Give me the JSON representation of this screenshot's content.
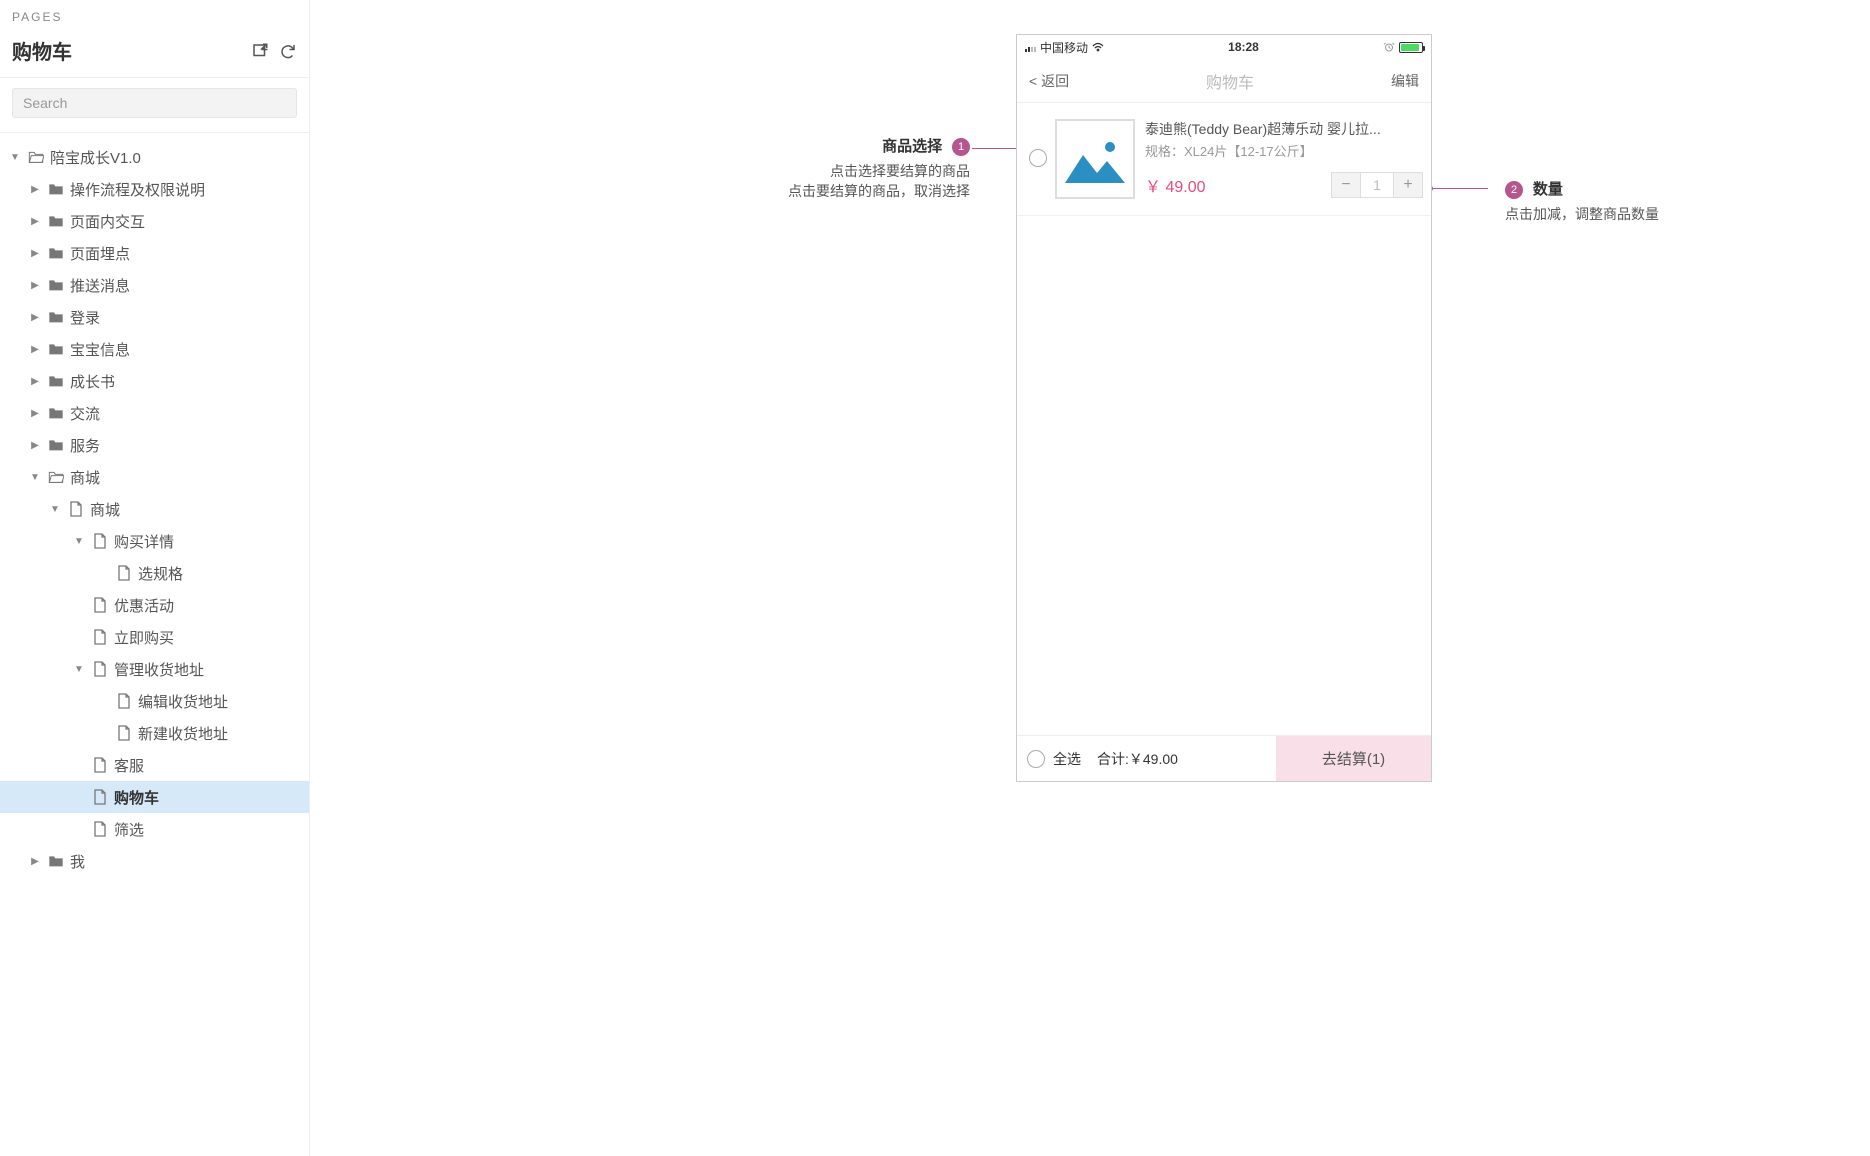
{
  "sidebar": {
    "header": "PAGES",
    "current_page": "购物车",
    "search_placeholder": "Search",
    "tree": [
      {
        "label": "陪宝成长V1.0",
        "indent": 0,
        "icon": "folder-open",
        "caret": "down"
      },
      {
        "label": "操作流程及权限说明",
        "indent": 1,
        "icon": "folder",
        "caret": "right"
      },
      {
        "label": "页面内交互",
        "indent": 1,
        "icon": "folder",
        "caret": "right"
      },
      {
        "label": "页面埋点",
        "indent": 1,
        "icon": "folder",
        "caret": "right"
      },
      {
        "label": "推送消息",
        "indent": 1,
        "icon": "folder",
        "caret": "right"
      },
      {
        "label": "登录",
        "indent": 1,
        "icon": "folder",
        "caret": "right"
      },
      {
        "label": "宝宝信息",
        "indent": 1,
        "icon": "folder",
        "caret": "right"
      },
      {
        "label": "成长书",
        "indent": 1,
        "icon": "folder",
        "caret": "right"
      },
      {
        "label": "交流",
        "indent": 1,
        "icon": "folder",
        "caret": "right"
      },
      {
        "label": "服务",
        "indent": 1,
        "icon": "folder",
        "caret": "right"
      },
      {
        "label": "商城",
        "indent": 1,
        "icon": "folder-open",
        "caret": "down"
      },
      {
        "label": "商城",
        "indent": 2,
        "icon": "page",
        "caret": "down"
      },
      {
        "label": "购买详情",
        "indent": 3,
        "icon": "page",
        "caret": "down"
      },
      {
        "label": "选规格",
        "indent": 4,
        "icon": "page",
        "caret": "none"
      },
      {
        "label": "优惠活动",
        "indent": 3,
        "icon": "page",
        "caret": "none"
      },
      {
        "label": "立即购买",
        "indent": 3,
        "icon": "page",
        "caret": "none"
      },
      {
        "label": "管理收货地址",
        "indent": 3,
        "icon": "page",
        "caret": "down"
      },
      {
        "label": "编辑收货地址",
        "indent": 4,
        "icon": "page",
        "caret": "none"
      },
      {
        "label": "新建收货地址",
        "indent": 4,
        "icon": "page",
        "caret": "none"
      },
      {
        "label": "客服",
        "indent": 3,
        "icon": "page",
        "caret": "none"
      },
      {
        "label": "购物车",
        "indent": 3,
        "icon": "page",
        "caret": "none",
        "active": true
      },
      {
        "label": "筛选",
        "indent": 3,
        "icon": "page",
        "caret": "none"
      },
      {
        "label": "我",
        "indent": 1,
        "icon": "folder",
        "caret": "right"
      }
    ]
  },
  "phone": {
    "carrier": "中国移动",
    "time": "18:28",
    "nav_back": "< 返回",
    "nav_title": "购物车",
    "nav_action": "编辑",
    "item": {
      "title": "泰迪熊(Teddy Bear)超薄乐动 婴儿拉...",
      "spec": "规格：XL24片【12-17公斤】",
      "price": "￥ 49.00",
      "qty": "1"
    },
    "footer": {
      "select_all": "全选",
      "total_label": "合计:",
      "total_value": "￥49.00",
      "checkout": "去结算(1)"
    }
  },
  "annotations": {
    "left": {
      "badge": "1",
      "title": "商品选择",
      "line1": "点击选择要结算的商品",
      "line2": "点击要结算的商品，取消选择"
    },
    "right": {
      "badge": "2",
      "title": "数量",
      "line1": "点击加减，调整商品数量"
    }
  }
}
